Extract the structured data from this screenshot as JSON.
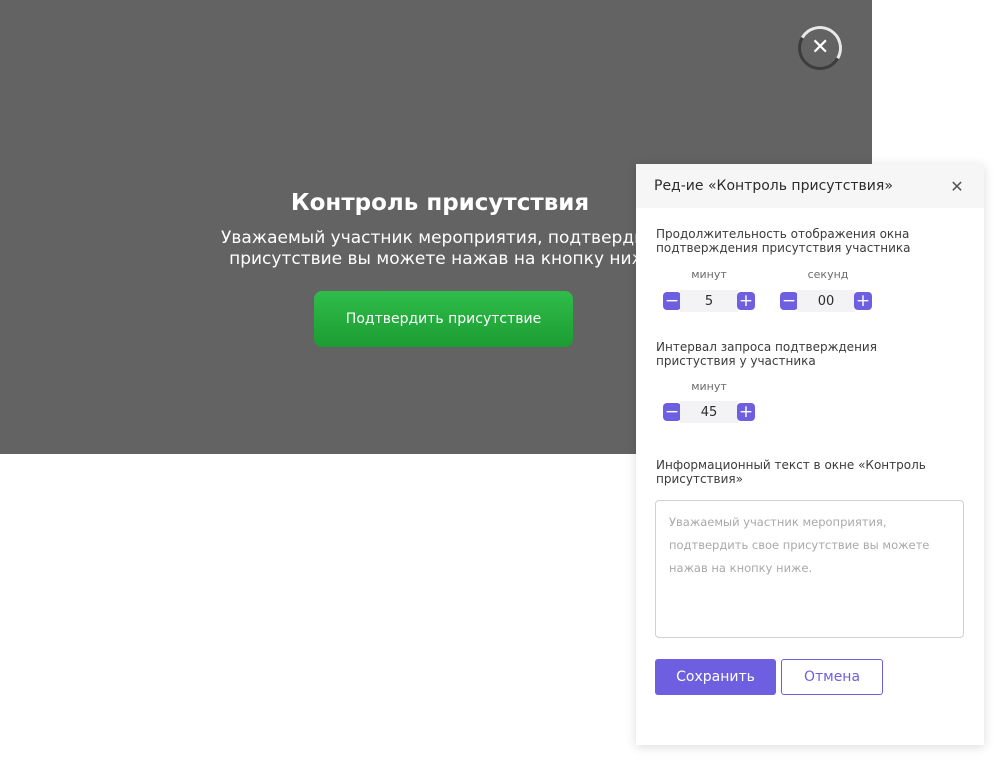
{
  "preview": {
    "title": "Контроль присутствия",
    "text_line1": "Уважаемый участник мероприятия, подтвердит",
    "text_line2": "присутствие вы можете нажав на кнопку ниж",
    "confirm_button": "Подтвердить присутствие",
    "close_icon": "close-icon",
    "confirm_color": "#2fbd4a"
  },
  "panel": {
    "title": "Ред-ие «Контроль присутствия»",
    "close_glyph": "✕",
    "duration": {
      "label": "Продолжительность отображения окна подтверждения присутствия участника",
      "minutes_label": "минут",
      "minutes_value": "5",
      "seconds_label": "секунд",
      "seconds_value": "00"
    },
    "interval": {
      "label": "Интервал запроса подтверждения пристуствия у участника",
      "minutes_label": "минут",
      "minutes_value": "45"
    },
    "info": {
      "label": "Информационный текст в окне «Контроль присутствия»",
      "placeholder": "Уважаемый участник мероприятия, подтвердить свое присутствие вы можете нажав на кнопку ниже."
    },
    "save_button": "Сохранить",
    "cancel_button": "Отмена",
    "accent_color": "#6d5fe0"
  }
}
